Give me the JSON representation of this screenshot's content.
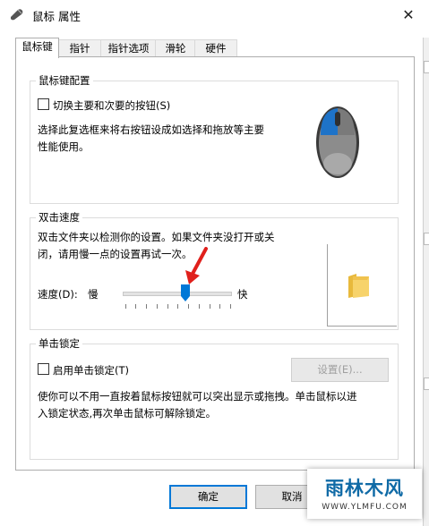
{
  "window": {
    "title": "鼠标 属性",
    "close_glyph": "✕"
  },
  "tabs": [
    {
      "label": "鼠标键"
    },
    {
      "label": "指针"
    },
    {
      "label": "指针选项"
    },
    {
      "label": "滑轮"
    },
    {
      "label": "硬件"
    }
  ],
  "button_config": {
    "group_title": "鼠标键配置",
    "checkbox_label": "切换主要和次要的按钮(S)",
    "checkbox_checked": false,
    "description_line1": "选择此复选框来将右按钮设成如选择和拖放等主要",
    "description_line2": "性能使用。"
  },
  "double_click": {
    "group_title": "双击速度",
    "description_line1": "双击文件夹以检测你的设置。如果文件夹没打开或关",
    "description_line2": "闭，请用慢一点的设置再试一次。",
    "speed_label": "速度(D):",
    "slow_label": "慢",
    "fast_label": "快",
    "slider_value_fraction": 0.55
  },
  "click_lock": {
    "group_title": "单击锁定",
    "checkbox_label": "启用单击锁定(T)",
    "checkbox_checked": false,
    "settings_button": "设置(E)...",
    "description_line1": "使你可以不用一直按着鼠标按钮就可以突出显示或拖拽。单击鼠标以进",
    "description_line2": "入锁定状态,再次单击鼠标可解除锁定。"
  },
  "footer": {
    "ok_label": "确定",
    "cancel_label": "取消"
  },
  "watermark": {
    "name": "雨林木风",
    "url": "WWW.YLMFU.COM"
  },
  "colors": {
    "accent": "#0078d7",
    "mouse_blue": "#1e73c8"
  },
  "icons": {
    "title": "mouse-icon",
    "preview": "mouse-illustration",
    "folder": "folder-icon"
  }
}
